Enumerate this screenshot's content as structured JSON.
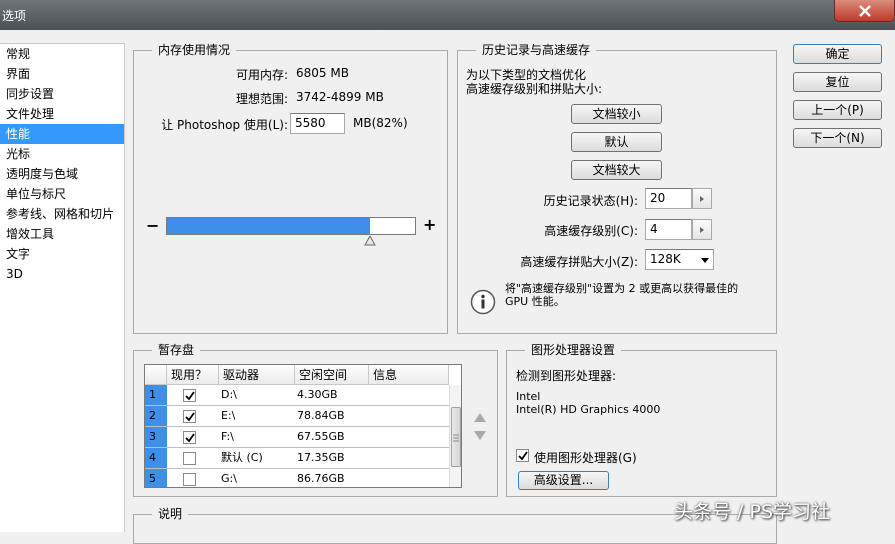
{
  "window": {
    "title": "选项"
  },
  "nav": {
    "items": [
      "常规",
      "界面",
      "同步设置",
      "文件处理",
      "性能",
      "光标",
      "透明度与色域",
      "单位与标尺",
      "参考线、网格和切片",
      "增效工具",
      "文字",
      "3D"
    ],
    "selected": "性能"
  },
  "memory": {
    "title": "内存使用情况",
    "available_label": "可用内存:",
    "available_value": "6805 MB",
    "ideal_label": "理想范围:",
    "ideal_value": "3742-4899 MB",
    "let_label": "让 Photoshop 使用(L):",
    "let_value": "5580",
    "let_suffix": "MB(82%)",
    "usage_fraction": 0.82,
    "minus": "−",
    "plus": "+"
  },
  "history": {
    "title": "历史记录与高速缓存",
    "desc_line1": "为以下类型的文档优化",
    "desc_line2": "高速缓存级别和拼贴大小:",
    "btn_small": "文档较小",
    "btn_default": "默认",
    "btn_large": "文档较大",
    "states_label": "历史记录状态(H):",
    "states_value": "20",
    "levels_label": "高速缓存级别(C):",
    "levels_value": "4",
    "tile_label": "高速缓存拼贴大小(Z):",
    "tile_value": "128K",
    "info_text_line1": "将\"高速缓存级别\"设置为 2 或更高以获得最佳的",
    "info_text_line2": "GPU 性能。"
  },
  "scratch": {
    "title": "暂存盘",
    "headers": [
      "现用？",
      "驱动器",
      "空闲空间",
      "信息"
    ],
    "rows": [
      {
        "num": "1",
        "active": true,
        "drive": "D:\\",
        "free": "4.30GB",
        "info": ""
      },
      {
        "num": "2",
        "active": true,
        "drive": "E:\\",
        "free": "78.84GB",
        "info": ""
      },
      {
        "num": "3",
        "active": true,
        "drive": "F:\\",
        "free": "67.55GB",
        "info": ""
      },
      {
        "num": "4",
        "active": false,
        "drive": "默认 (C)",
        "free": "17.35GB",
        "info": ""
      },
      {
        "num": "5",
        "active": false,
        "drive": "G:\\",
        "free": "86.76GB",
        "info": ""
      }
    ]
  },
  "gpu": {
    "title": "图形处理器设置",
    "detected_label": "检测到图形处理器:",
    "vendor": "Intel",
    "model": "Intel(R) HD Graphics 4000",
    "use_gpu_label": "使用图形处理器(G)",
    "use_gpu_checked": true,
    "advanced_btn": "高级设置..."
  },
  "description": {
    "title": "说明"
  },
  "buttons": {
    "ok": "确定",
    "reset": "复位",
    "prev": "上一个(P)",
    "next": "下一个(N)"
  },
  "watermark": "头条号 / PS学习社",
  "colors": {
    "accent": "#3d8fe8",
    "selection": "#3399ff"
  }
}
